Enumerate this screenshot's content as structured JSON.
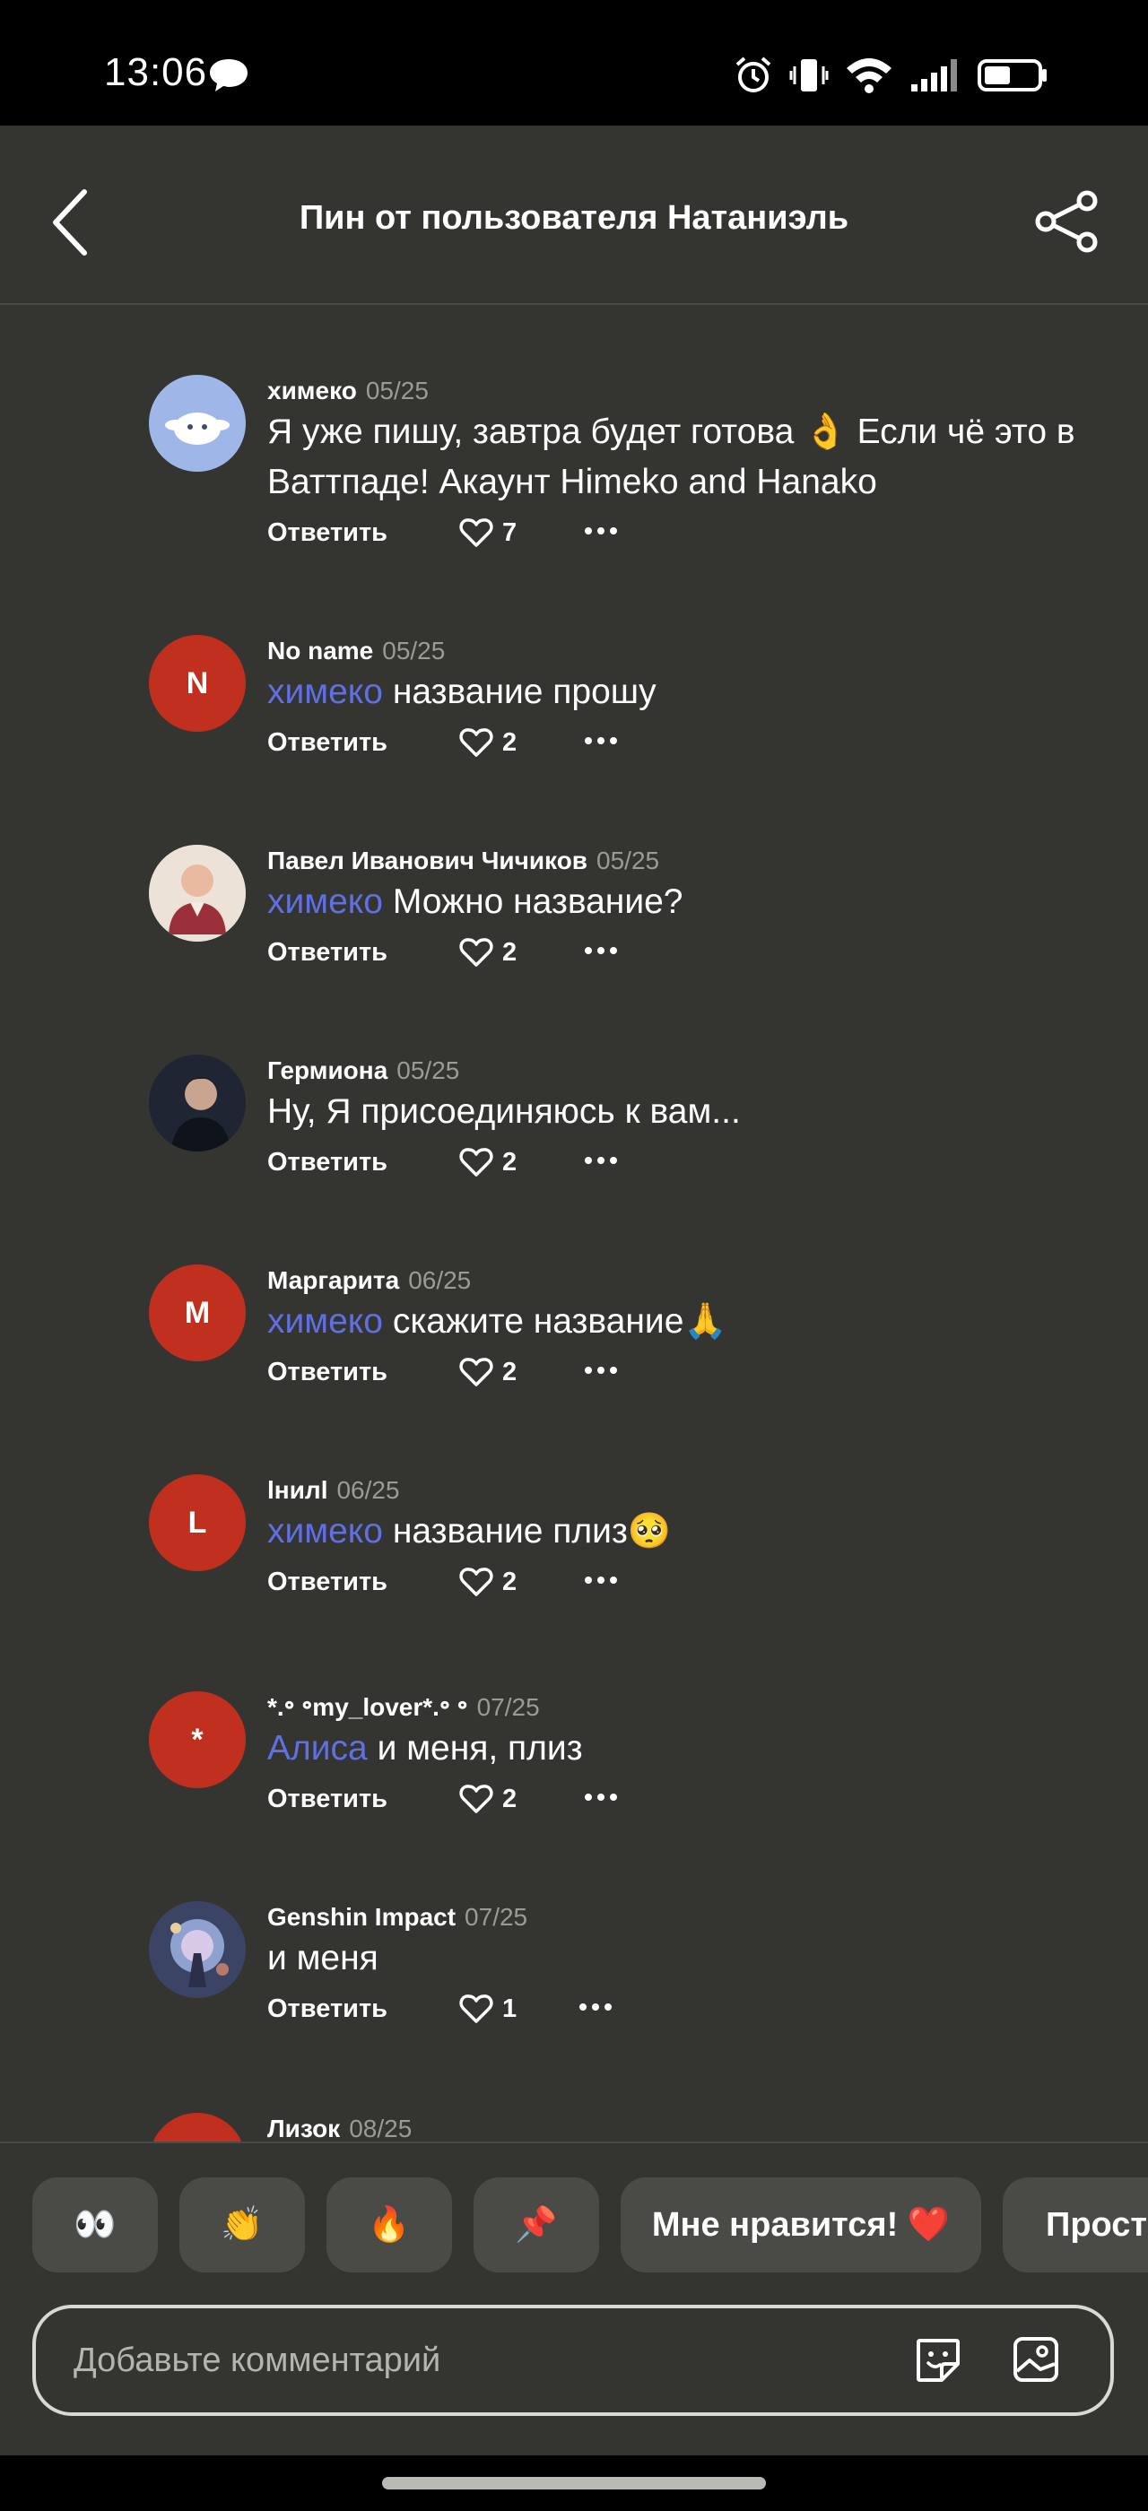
{
  "status_bar": {
    "time": "13:06",
    "icons": [
      "chat-bubble-icon",
      "alarm-icon",
      "vibrate-icon",
      "wifi-icon",
      "signal-icon",
      "battery-icon"
    ]
  },
  "header": {
    "title": "Пин от пользователя Натаниэль",
    "back_icon": "chevron-left-icon",
    "share_icon": "share-icon"
  },
  "colors": {
    "background": "#343431",
    "mention": "#5f6fe4",
    "avatar_letter_bg": "#c1301e",
    "chip_bg": "#4a4a47"
  },
  "reply_label": "Ответить",
  "comments": [
    {
      "author": "химеко",
      "date": "05/25",
      "mention": "",
      "text": "Я уже пишу, завтра будет готова 👌 Если чё это в Ваттпаде! Акаунт Himeko and Hanako",
      "likes": "7",
      "avatar": {
        "type": "image",
        "icon": "cinnamoroll-avatar"
      }
    },
    {
      "author": "No name",
      "date": "05/25",
      "mention": "химеко",
      "text": " название прошу",
      "likes": "2",
      "avatar": {
        "type": "letter",
        "letter": "N"
      }
    },
    {
      "author": "Павел Иванович Чичиков",
      "date": "05/25",
      "mention": "химеко",
      "text": " Можно название?",
      "likes": "2",
      "avatar": {
        "type": "image",
        "icon": "portrait-avatar"
      }
    },
    {
      "author": "Гермиона",
      "date": "05/25",
      "mention": "",
      "text": "Ну, Я присоединяюсь к вам...",
      "likes": "2",
      "avatar": {
        "type": "image",
        "icon": "photo-avatar"
      }
    },
    {
      "author": "Маргарита",
      "date": "06/25",
      "mention": "химеко",
      "text": " скажите название🙏",
      "likes": "2",
      "avatar": {
        "type": "letter",
        "letter": "M"
      }
    },
    {
      "author": "lнилl",
      "date": "06/25",
      "mention": "химеко",
      "text": " название плиз🥺",
      "likes": "2",
      "avatar": {
        "type": "letter",
        "letter": "L"
      }
    },
    {
      "author": "*.॰ ॰my_lover*.॰ ॰",
      "date": "07/25",
      "mention": "Алиса",
      "text": " и меня, плиз",
      "likes": "2",
      "avatar": {
        "type": "letter",
        "letter": "*"
      }
    },
    {
      "author": "Genshin Impact",
      "date": "07/25",
      "mention": "",
      "text": "и меня",
      "likes": "1",
      "avatar": {
        "type": "image",
        "icon": "game-art-avatar"
      }
    },
    {
      "author": "Лизок",
      "date": "08/25",
      "mention": "",
      "text": "",
      "likes": "",
      "avatar": {
        "type": "letter",
        "letter": ""
      }
    }
  ],
  "reactions": [
    {
      "label": "👀",
      "name": "eyes"
    },
    {
      "label": "👏",
      "name": "clap"
    },
    {
      "label": "🔥",
      "name": "fire"
    },
    {
      "label": "📌",
      "name": "pin"
    },
    {
      "label": "Мне нравится! ❤️",
      "name": "love-it"
    },
    {
      "label": "Просто",
      "name": "simple"
    }
  ],
  "comment_input": {
    "placeholder": "Добавьте комментарий",
    "sticker_icon": "sticker-icon",
    "image_icon": "image-icon"
  }
}
